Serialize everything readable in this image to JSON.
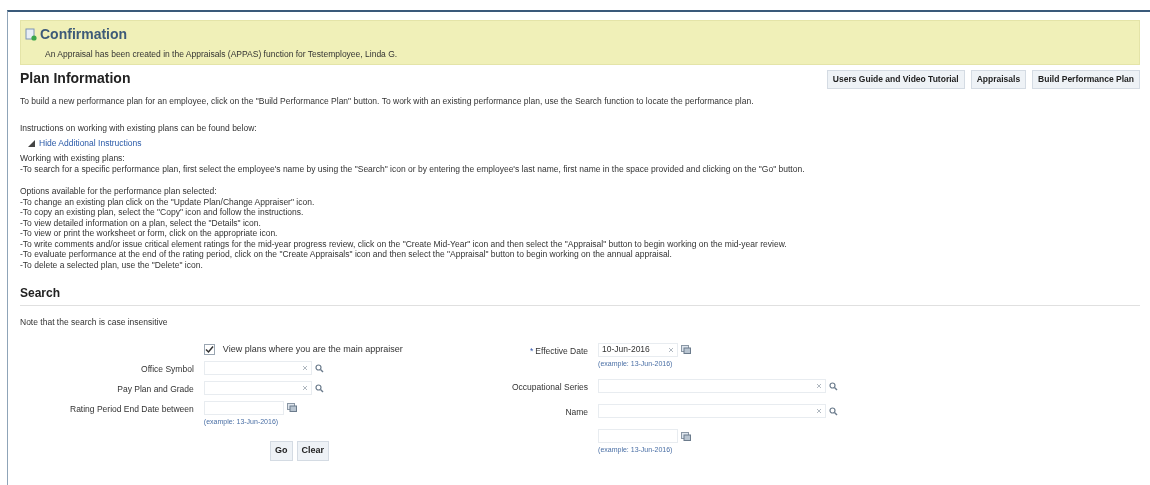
{
  "confirmation": {
    "title": "Confirmation",
    "message": "An Appraisal has been created in the Appraisals (APPAS) function for Testemployee, Linda G."
  },
  "plan_information": {
    "title": "Plan Information",
    "buttons": [
      {
        "label": "Users Guide and Video Tutorial"
      },
      {
        "label": "Appraisals"
      },
      {
        "label": "Build Performance Plan"
      }
    ],
    "intro": "To build a new performance plan for an employee, click on the \"Build Performance Plan\" button. To work with an existing performance plan, use the Search function to locate the performance plan.",
    "instructions_note": "Instructions on working with existing plans can be found below:",
    "toggle_link": {
      "label": "Hide Additional Instructions",
      "expanded": true
    },
    "working_lines": [
      "Working with existing plans:",
      "-To search for a specific performance plan, first select the employee's name by using the \"Search\" icon or by entering the employee's last name, first name in the space provided and clicking on the \"Go\" button."
    ],
    "options_lines": [
      "Options available for the performance plan selected:",
      "-To change an existing plan click on the \"Update Plan/Change Appraiser\" icon.",
      "-To copy an existing plan, select the \"Copy\" icon and follow the instructions.",
      "-To view detailed information on a plan, select the \"Details\" icon.",
      "-To view or print the worksheet or form, click on the appropriate icon.",
      "-To write comments and/or issue critical element ratings for the mid-year progress review, click on the \"Create Mid-Year\" icon and then select the \"Appraisal\" button to begin working on the mid-year review.",
      "-To evaluate performance at the end of the rating period, click on the \"Create Appraisals\" icon and then select the \"Appraisal\" button to begin working on the annual appraisal.",
      "-To delete a selected plan, use the \"Delete\" icon."
    ]
  },
  "search": {
    "title": "Search",
    "note": "Note that the search is case insensitive",
    "checkbox": {
      "label": "View plans where you are the main appraiser",
      "checked": true
    },
    "left_fields": [
      {
        "kind": "lov",
        "label": "Office Symbol"
      },
      {
        "kind": "lov",
        "label": "Pay Plan and Grade"
      },
      {
        "kind": "date",
        "label": "Rating Period End Date between",
        "example": "(example: 13-Jun-2016)"
      }
    ],
    "right_fields": [
      {
        "kind": "date",
        "label": "Effective Date",
        "required_mark": "*",
        "value": "10-Jun-2016",
        "example": "(example: 13-Jun-2016)"
      },
      {
        "kind": "lov",
        "label": "Occupational Series"
      },
      {
        "kind": "lov",
        "label": "Name"
      },
      {
        "kind": "date",
        "example": "(example: 13-Jun-2016)"
      }
    ],
    "buttons": [
      {
        "label": "Go"
      },
      {
        "label": "Clear"
      }
    ]
  }
}
